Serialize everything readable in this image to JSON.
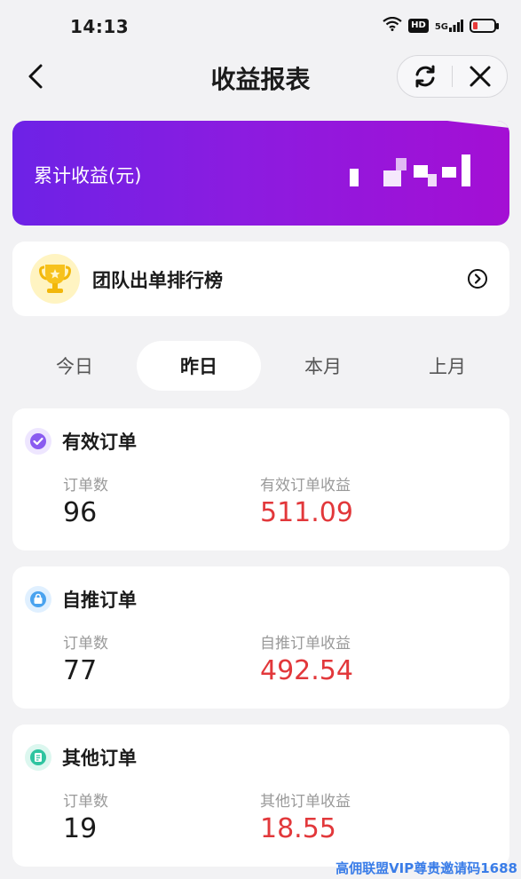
{
  "status_bar": {
    "time": "14:13",
    "hd": "HD",
    "signal": "5G",
    "wifi_icon": "wifi-icon",
    "battery_icon": "battery-low-icon"
  },
  "nav": {
    "title": "收益报表",
    "back_icon": "chevron-left-icon",
    "refresh_icon": "refresh-icon",
    "close_icon": "close-icon"
  },
  "earnings": {
    "label": "累计收益(元)",
    "value_obscured": true
  },
  "ranking": {
    "label": "团队出单排行榜",
    "icon": "trophy-icon",
    "arrow_icon": "chevron-right-circle-icon"
  },
  "period_tabs": {
    "items": [
      "今日",
      "昨日",
      "本月",
      "上月"
    ],
    "selected": "昨日"
  },
  "orders": [
    {
      "title": "有效订单",
      "icon": "check-badge-icon",
      "icon_color": "#8a5bf0",
      "count_label": "订单数",
      "count": "96",
      "income_label": "有效订单收益",
      "income": "511.09"
    },
    {
      "title": "自推订单",
      "icon": "bag-icon",
      "icon_color": "#4aa3ef",
      "count_label": "订单数",
      "count": "77",
      "income_label": "自推订单收益",
      "income": "492.54"
    },
    {
      "title": "其他订单",
      "icon": "note-icon",
      "icon_color": "#2ec4a0",
      "count_label": "订单数",
      "count": "19",
      "income_label": "其他订单收益",
      "income": "18.55"
    }
  ],
  "colors": {
    "accent_purple": "#8b1ce0",
    "income_red": "#e2383b",
    "watermark_blue": "#3a7de8"
  },
  "watermark": "高佣联盟VIP尊贵邀请码1688"
}
